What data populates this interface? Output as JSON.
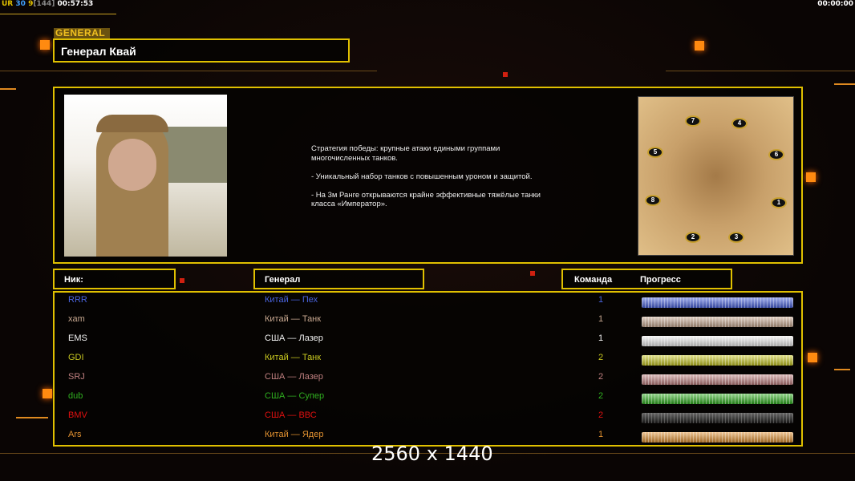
{
  "hud": {
    "ur": "UR",
    "a": "30",
    "b": "9",
    "c": "[144]",
    "time": "00:57:53",
    "timer_right": "00:00:00"
  },
  "general_tag": "GENERAL",
  "general_name": "Генерал Квай",
  "description": "Стратегия победы: крупные атаки едиными группами\n многочисленных танков.\n\n- Уникальный набор танков с повышенным уроном и защитой.\n\n- На 3м Ранге открываются крайне эффективные тяжёлые танки\n класса «Император».",
  "map": {
    "spawns": [
      "7",
      "4",
      "5",
      "6",
      "8",
      "1",
      "2",
      "3"
    ]
  },
  "headers": {
    "nick": "Ник:",
    "general": "Генерал",
    "team": "Команда",
    "progress": "Прогресс"
  },
  "players": [
    {
      "nick": "RRR",
      "general": "Китай — Пех",
      "team": "1",
      "progress": 1,
      "color": "#4a64e0"
    },
    {
      "nick": "xam",
      "general": "Китай — Танк",
      "team": "1",
      "progress": 1,
      "color": "#c8a890"
    },
    {
      "nick": "EMS",
      "general": "США — Лазер",
      "team": "1",
      "progress": 1,
      "color": "#f0f0f0"
    },
    {
      "nick": "GDI",
      "general": "Китай — Танк",
      "team": "2",
      "progress": 1,
      "color": "#c8c820"
    },
    {
      "nick": "SRJ",
      "general": "США — Лазер",
      "team": "2",
      "progress": 1,
      "color": "#c08080"
    },
    {
      "nick": "dub",
      "general": "США — Супер",
      "team": "2",
      "progress": 1,
      "color": "#30b020"
    },
    {
      "nick": "BMV",
      "general": "США — ВВС",
      "team": "2",
      "progress": 0,
      "color": "#e01010"
    },
    {
      "nick": "Ars",
      "general": "Китай — Ядер",
      "team": "1",
      "progress": 1,
      "color": "#e09030"
    }
  ],
  "watermark": "2560 x 1440"
}
